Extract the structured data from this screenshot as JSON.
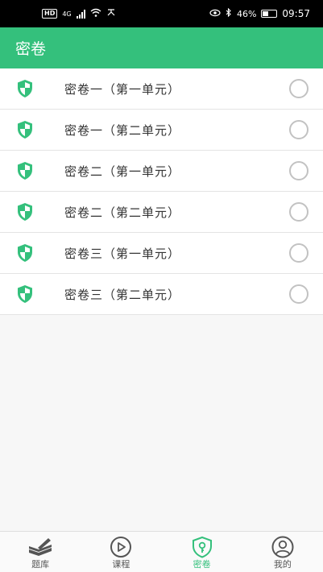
{
  "status_bar": {
    "network": "4G",
    "battery": "46%",
    "time": "09:57"
  },
  "header": {
    "title": "密卷"
  },
  "colors": {
    "accent": "#34c07c"
  },
  "list": {
    "items": [
      {
        "label": "密卷一（第一单元）",
        "selected": false
      },
      {
        "label": "密卷一（第二单元）",
        "selected": false
      },
      {
        "label": "密卷二（第一单元）",
        "selected": false
      },
      {
        "label": "密卷二（第二单元）",
        "selected": false
      },
      {
        "label": "密卷三（第一单元）",
        "selected": false
      },
      {
        "label": "密卷三（第二单元）",
        "selected": false
      }
    ]
  },
  "tabbar": {
    "tabs": [
      {
        "label": "题库",
        "icon": "book-icon",
        "active": false
      },
      {
        "label": "课程",
        "icon": "play-icon",
        "active": false
      },
      {
        "label": "密卷",
        "icon": "shield-key-icon",
        "active": true
      },
      {
        "label": "我的",
        "icon": "user-icon",
        "active": false
      }
    ]
  }
}
